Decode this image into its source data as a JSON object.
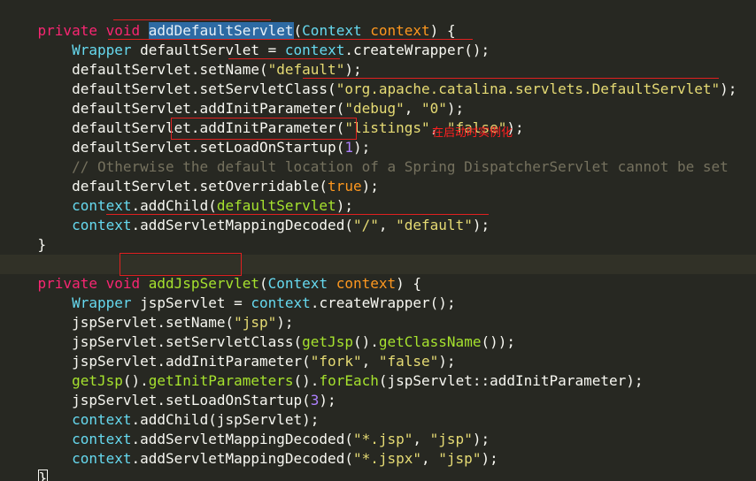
{
  "colors": {
    "background": "#272822",
    "keyword": "#f92672",
    "type": "#66d9ef",
    "function": "#a6e22e",
    "string": "#e6db74",
    "number": "#ae81ff",
    "comment": "#75715e",
    "variable": "#fd971f",
    "annotation": "#e02020"
  },
  "annotation": {
    "text": "在启动时实例化"
  },
  "code": {
    "m1": {
      "sig_kw": "private void ",
      "name": "addDefaultServlet",
      "paren_open": "(",
      "param_type": "Context",
      "param_name": " context",
      "paren_close": ") {"
    },
    "l1": {
      "indent": "    ",
      "type": "Wrapper",
      "var": " defaultServlet",
      "eq": " = ",
      "obj": "context",
      "call": ".createWrapper();"
    },
    "l2": {
      "indent": "    ",
      "obj": "defaultServlet",
      "call": ".setName(",
      "str": "\"default\"",
      "end": ");"
    },
    "l3": {
      "indent": "    ",
      "obj": "defaultServlet",
      "call": ".setServletClass(",
      "str": "\"org.apache.catalina.servlets.DefaultServlet\"",
      "end": ");"
    },
    "l4": {
      "indent": "    ",
      "obj": "defaultServlet",
      "call": ".addInitParameter(",
      "str1": "\"debug\"",
      "sep": ", ",
      "str2": "\"0\"",
      "end": ");"
    },
    "l5": {
      "indent": "    ",
      "obj": "defaultServlet",
      "call": ".addInitParameter(",
      "str1": "\"listings\"",
      "sep": ", ",
      "str2": "\"false\"",
      "end": ");"
    },
    "l6": {
      "indent": "    ",
      "obj": "defaultServlet",
      "dot": ".",
      "call": "setLoadOnStartup(",
      "num": "1",
      "end": ");"
    },
    "l7": {
      "indent": "    ",
      "comment": "// Otherwise the default location of a Spring DispatcherServlet cannot be set"
    },
    "l8": {
      "indent": "    ",
      "obj": "defaultServlet",
      "call": ".setOverridable(",
      "kw": "true",
      "end": ");"
    },
    "l9": {
      "indent": "    ",
      "obj": "context",
      "call": ".addChild(",
      "arg": "defaultServlet",
      "end": ");"
    },
    "l10": {
      "indent": "    ",
      "obj": "context",
      "call": ".addServletMappingDecoded(",
      "str1": "\"/\"",
      "sep": ", ",
      "str2": "\"default\"",
      "end": ");"
    },
    "close1": "}",
    "m2": {
      "sig_kw": "private void ",
      "name": "addJspServlet",
      "paren_open": "(",
      "param_type": "Context",
      "param_name": " context",
      "paren_close": ") {"
    },
    "j1": {
      "indent": "    ",
      "type": "Wrapper",
      "var": " jspServlet",
      "eq": " = ",
      "obj": "context",
      "call": ".createWrapper();"
    },
    "j2": {
      "indent": "    ",
      "obj": "jspServlet",
      "call": ".setName(",
      "str": "\"jsp\"",
      "end": ");"
    },
    "j3": {
      "indent": "    ",
      "obj": "jspServlet",
      "call": ".setServletClass(",
      "fn1": "getJsp",
      "mid": "().",
      "fn2": "getClassName",
      "end": "());"
    },
    "j4": {
      "indent": "    ",
      "obj": "jspServlet",
      "call": ".addInitParameter(",
      "str1": "\"fork\"",
      "sep": ", ",
      "str2": "\"false\"",
      "end": ");"
    },
    "j5": {
      "indent": "    ",
      "fn1": "getJsp",
      "mid1": "().",
      "fn2": "getInitParameters",
      "mid2": "().",
      "fn3": "forEach",
      "mid3": "(",
      "arg": "jspServlet",
      "ref": "::addInitParameter",
      "end": ");"
    },
    "j6": {
      "indent": "    ",
      "obj": "jspServlet",
      "call": ".setLoadOnStartup(",
      "num": "3",
      "end": ");"
    },
    "j7": {
      "indent": "    ",
      "obj": "context",
      "call": ".addChild(",
      "arg": "jspServlet",
      "end": ");"
    },
    "j8": {
      "indent": "    ",
      "obj": "context",
      "call": ".addServletMappingDecoded(",
      "str1": "\"*.jsp\"",
      "sep": ", ",
      "str2": "\"jsp\"",
      "end": ");"
    },
    "j9": {
      "indent": "    ",
      "obj": "context",
      "call": ".addServletMappingDecoded(",
      "str1": "\"*.jspx\"",
      "sep": ", ",
      "str2": "\"jsp\"",
      "end": ");"
    },
    "close2": "}"
  }
}
